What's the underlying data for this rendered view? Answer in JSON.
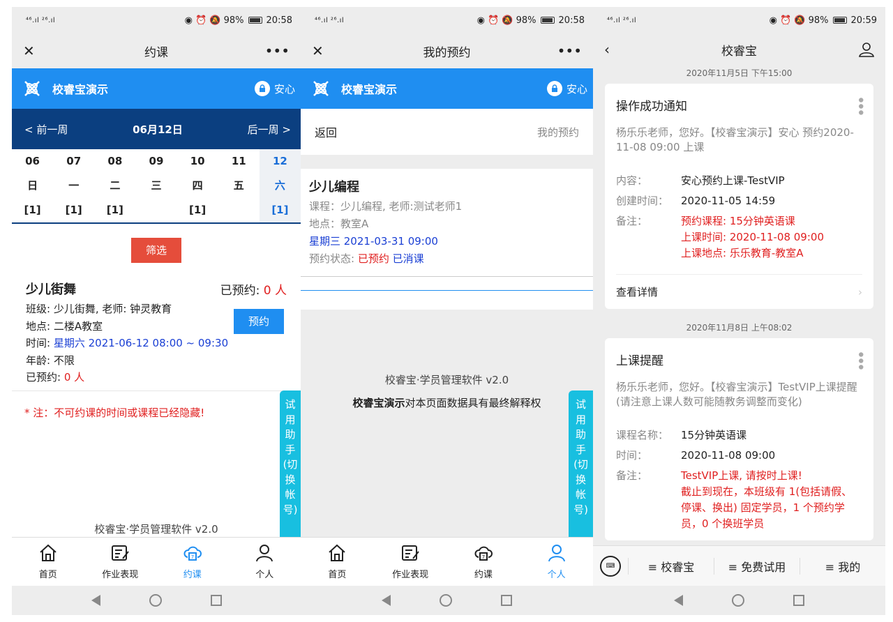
{
  "status": {
    "signal": "⁴⁶.ıl ²⁶.ıl",
    "battery": "98%",
    "time1": "20:58",
    "time2": "20:58",
    "time3": "20:59"
  },
  "p1": {
    "title": "约课",
    "brand": "校睿宝演示",
    "brand_right": "安心",
    "prev_week": "< 前一周",
    "date": "06月12日",
    "next_week": "后一周 >",
    "days": [
      {
        "num": "06",
        "wd": "日",
        "cnt": "[1]"
      },
      {
        "num": "07",
        "wd": "一",
        "cnt": "[1]"
      },
      {
        "num": "08",
        "wd": "二",
        "cnt": "[1]"
      },
      {
        "num": "09",
        "wd": "三",
        "cnt": ""
      },
      {
        "num": "10",
        "wd": "四",
        "cnt": "[1]"
      },
      {
        "num": "11",
        "wd": "五",
        "cnt": ""
      },
      {
        "num": "12",
        "wd": "六",
        "cnt": "[1]"
      }
    ],
    "filter": "筛选",
    "course": {
      "name": "少儿街舞",
      "booked_label": "已预约:",
      "booked_count": "0 人",
      "class": "班级: 少儿街舞, 老师: 钟灵教育",
      "place": "地点: 二楼A教室",
      "time_label": "时间:",
      "time_value": "星期六 2021-06-12 08:00 ~ 09:30",
      "age": "年龄: 不限",
      "booked2_label": "已预约:",
      "booked2_count": "0 人",
      "book_btn": "预约"
    },
    "note": "* 注：不可约课的时间或课程已经隐藏!",
    "version": "校睿宝·学员管理软件 v2.0"
  },
  "tabs": [
    "首页",
    "作业表现",
    "约课",
    "个人"
  ],
  "float_btn": [
    "试",
    "用",
    "助",
    "手",
    "(切",
    "换",
    "帐",
    "号)"
  ],
  "p2": {
    "title": "我的预约",
    "back": "返回",
    "crumb": "我的预约",
    "course": "少儿编程",
    "detail": "课程：少儿编程, 老师:测试老师1",
    "place": "地点：教室A",
    "datetime": "星期三 2021-03-31 09:00",
    "status_label": "预约状态:",
    "status_booked": "已预约",
    "status_done": "已消课",
    "version": "校睿宝·学员管理软件 v2.0",
    "rights_bold": "校睿宝演示",
    "rights_rest": "对本页面数据具有最终解释权"
  },
  "p3": {
    "title": "校睿宝",
    "ts1": "2020年11月5日 下午15:00",
    "msg1": {
      "title": "操作成功通知",
      "intro": "杨乐乐老师，您好。【校睿宝演示】安心 预约2020-11-08 09:00 上课",
      "k1": "内容：",
      "v1": "安心预约上课-TestVIP",
      "k2": "创建时间：",
      "v2": "2020-11-05 14:59",
      "k3": "备注：",
      "v3a": "预约课程: 15分钟英语课",
      "v3b": "上课时间: 2020-11-08 09:00",
      "v3c": "上课地点: 乐乐教育-教室A",
      "detail": "查看详情"
    },
    "ts2": "2020年11月8日 上午08:02",
    "msg2": {
      "title": "上课提醒",
      "intro": "杨乐乐老师，您好。【校睿宝演示】TestVIP上课提醒(请注意上课人数可能随教务调整而变化)",
      "k1": "课程名称：",
      "v1": "15分钟英语课",
      "k2": "时间：",
      "v2": "2020-11-08 09:00",
      "k3": "备注：",
      "v3a": "TestVIP上课, 请按时上课!",
      "v3b": "截止到现在，本班级有 1(包括请假、停课、换出) 固定学员，1 个预约学员，0 个换班学员"
    },
    "menus": [
      "≡ 校睿宝",
      "≡ 免费试用",
      "≡ 我的"
    ]
  },
  "colors": {
    "brand_blue": "#1f8ef1",
    "nav_dark": "#0b3f80",
    "filter_red": "#e54d3b",
    "float_cyan": "#18bfe0"
  }
}
